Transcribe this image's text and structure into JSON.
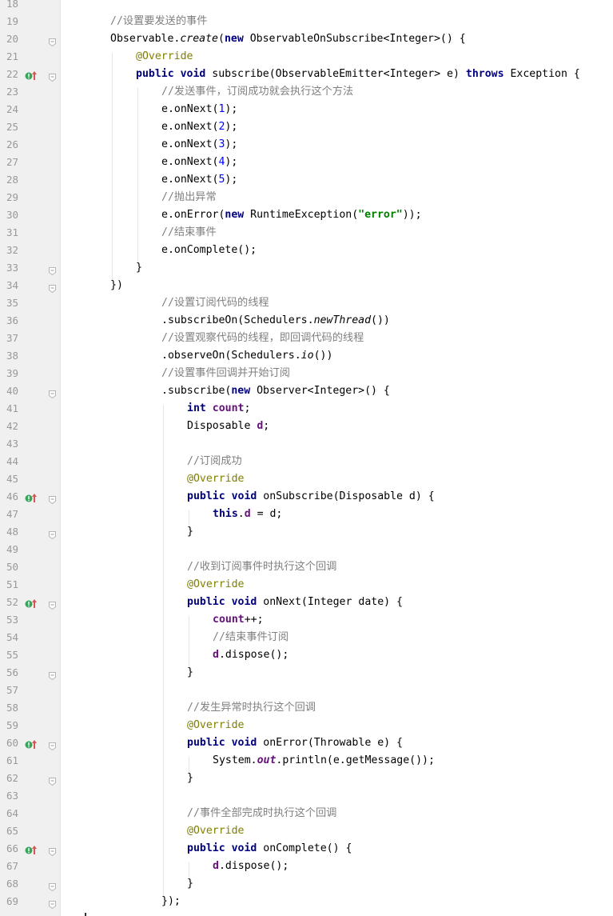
{
  "editor": {
    "lines": [
      {
        "n": "18",
        "indent": 0,
        "fold": false,
        "mark": false,
        "tokens": []
      },
      {
        "n": "19",
        "indent": 0,
        "fold": false,
        "mark": false,
        "tokens": [
          [
            "c",
            "//设置要发送的事件"
          ]
        ]
      },
      {
        "n": "20",
        "indent": 0,
        "fold": true,
        "mark": false,
        "tokens": [
          [
            "",
            "Observable."
          ],
          [
            "i",
            "create"
          ],
          [
            "",
            "("
          ],
          [
            "k",
            "new"
          ],
          [
            "",
            " ObservableOnSubscribe<Integer>() {"
          ]
        ]
      },
      {
        "n": "21",
        "indent": 1,
        "fold": false,
        "mark": false,
        "tokens": [
          [
            "a",
            "@Override"
          ]
        ]
      },
      {
        "n": "22",
        "indent": 1,
        "fold": true,
        "mark": true,
        "tokens": [
          [
            "k",
            "public void"
          ],
          [
            "",
            " subscribe(ObservableEmitter<Integer> e) "
          ],
          [
            "k",
            "throws"
          ],
          [
            "",
            " Exception {"
          ]
        ]
      },
      {
        "n": "23",
        "indent": 2,
        "fold": false,
        "mark": false,
        "tokens": [
          [
            "c",
            "//发送事件，订阅成功就会执行这个方法"
          ]
        ]
      },
      {
        "n": "24",
        "indent": 2,
        "fold": false,
        "mark": false,
        "tokens": [
          [
            "",
            "e.onNext("
          ],
          [
            "n",
            "1"
          ],
          [
            "",
            ");"
          ]
        ]
      },
      {
        "n": "25",
        "indent": 2,
        "fold": false,
        "mark": false,
        "tokens": [
          [
            "",
            "e.onNext("
          ],
          [
            "n",
            "2"
          ],
          [
            "",
            ");"
          ]
        ]
      },
      {
        "n": "26",
        "indent": 2,
        "fold": false,
        "mark": false,
        "tokens": [
          [
            "",
            "e.onNext("
          ],
          [
            "n",
            "3"
          ],
          [
            "",
            ");"
          ]
        ]
      },
      {
        "n": "27",
        "indent": 2,
        "fold": false,
        "mark": false,
        "tokens": [
          [
            "",
            "e.onNext("
          ],
          [
            "n",
            "4"
          ],
          [
            "",
            ");"
          ]
        ]
      },
      {
        "n": "28",
        "indent": 2,
        "fold": false,
        "mark": false,
        "tokens": [
          [
            "",
            "e.onNext("
          ],
          [
            "n",
            "5"
          ],
          [
            "",
            ");"
          ]
        ]
      },
      {
        "n": "29",
        "indent": 2,
        "fold": false,
        "mark": false,
        "tokens": [
          [
            "c",
            "//抛出异常"
          ]
        ]
      },
      {
        "n": "30",
        "indent": 2,
        "fold": false,
        "mark": false,
        "tokens": [
          [
            "",
            "e.onError("
          ],
          [
            "k",
            "new"
          ],
          [
            "",
            " RuntimeException("
          ],
          [
            "s",
            "\"error\""
          ],
          [
            "",
            "));"
          ]
        ]
      },
      {
        "n": "31",
        "indent": 2,
        "fold": false,
        "mark": false,
        "tokens": [
          [
            "c",
            "//结束事件"
          ]
        ]
      },
      {
        "n": "32",
        "indent": 2,
        "fold": false,
        "mark": false,
        "tokens": [
          [
            "",
            "e.onComplete();"
          ]
        ]
      },
      {
        "n": "33",
        "indent": 1,
        "fold": true,
        "mark": false,
        "tokens": [
          [
            "",
            "}"
          ]
        ]
      },
      {
        "n": "34",
        "indent": 0,
        "fold": true,
        "mark": false,
        "tokens": [
          [
            "",
            "})"
          ]
        ]
      },
      {
        "n": "35",
        "indent": 2,
        "fold": false,
        "mark": false,
        "tokens": [
          [
            "c",
            "//设置订阅代码的线程"
          ]
        ]
      },
      {
        "n": "36",
        "indent": 2,
        "fold": false,
        "mark": false,
        "tokens": [
          [
            "",
            ".subscribeOn(Schedulers."
          ],
          [
            "i",
            "newThread"
          ],
          [
            "",
            "())"
          ]
        ]
      },
      {
        "n": "37",
        "indent": 2,
        "fold": false,
        "mark": false,
        "tokens": [
          [
            "c",
            "//设置观察代码的线程，即回调代码的线程"
          ]
        ]
      },
      {
        "n": "38",
        "indent": 2,
        "fold": false,
        "mark": false,
        "tokens": [
          [
            "",
            ".observeOn(Schedulers."
          ],
          [
            "i",
            "io"
          ],
          [
            "",
            "())"
          ]
        ]
      },
      {
        "n": "39",
        "indent": 2,
        "fold": false,
        "mark": false,
        "tokens": [
          [
            "c",
            "//设置事件回调并开始订阅"
          ]
        ]
      },
      {
        "n": "40",
        "indent": 2,
        "fold": true,
        "mark": false,
        "tokens": [
          [
            "",
            ".subscribe("
          ],
          [
            "k",
            "new"
          ],
          [
            "",
            " Observer<Integer>() {"
          ]
        ]
      },
      {
        "n": "41",
        "indent": 3,
        "fold": false,
        "mark": false,
        "tokens": [
          [
            "k",
            "int"
          ],
          [
            "",
            " "
          ],
          [
            "f",
            "count"
          ],
          [
            "",
            ";"
          ]
        ]
      },
      {
        "n": "42",
        "indent": 3,
        "fold": false,
        "mark": false,
        "tokens": [
          [
            "",
            "Disposable "
          ],
          [
            "f",
            "d"
          ],
          [
            "",
            ";"
          ]
        ]
      },
      {
        "n": "43",
        "indent": 3,
        "fold": false,
        "mark": false,
        "tokens": []
      },
      {
        "n": "44",
        "indent": 3,
        "fold": false,
        "mark": false,
        "tokens": [
          [
            "c",
            "//订阅成功"
          ]
        ]
      },
      {
        "n": "45",
        "indent": 3,
        "fold": false,
        "mark": false,
        "tokens": [
          [
            "a",
            "@Override"
          ]
        ]
      },
      {
        "n": "46",
        "indent": 3,
        "fold": true,
        "mark": true,
        "tokens": [
          [
            "k",
            "public void"
          ],
          [
            "",
            " onSubscribe(Disposable d) {"
          ]
        ]
      },
      {
        "n": "47",
        "indent": 4,
        "fold": false,
        "mark": false,
        "tokens": [
          [
            "k",
            "this"
          ],
          [
            "",
            "."
          ],
          [
            "f",
            "d"
          ],
          [
            "",
            " = d;"
          ]
        ]
      },
      {
        "n": "48",
        "indent": 3,
        "fold": true,
        "mark": false,
        "tokens": [
          [
            "",
            "}"
          ]
        ]
      },
      {
        "n": "49",
        "indent": 3,
        "fold": false,
        "mark": false,
        "tokens": []
      },
      {
        "n": "50",
        "indent": 3,
        "fold": false,
        "mark": false,
        "tokens": [
          [
            "c",
            "//收到订阅事件时执行这个回调"
          ]
        ]
      },
      {
        "n": "51",
        "indent": 3,
        "fold": false,
        "mark": false,
        "tokens": [
          [
            "a",
            "@Override"
          ]
        ]
      },
      {
        "n": "52",
        "indent": 3,
        "fold": true,
        "mark": true,
        "tokens": [
          [
            "k",
            "public void"
          ],
          [
            "",
            " onNext(Integer date) {"
          ]
        ]
      },
      {
        "n": "53",
        "indent": 4,
        "fold": false,
        "mark": false,
        "tokens": [
          [
            "f",
            "count"
          ],
          [
            "",
            "++;"
          ]
        ]
      },
      {
        "n": "54",
        "indent": 4,
        "fold": false,
        "mark": false,
        "tokens": [
          [
            "c",
            "//结束事件订阅"
          ]
        ]
      },
      {
        "n": "55",
        "indent": 4,
        "fold": false,
        "mark": false,
        "tokens": [
          [
            "f",
            "d"
          ],
          [
            "",
            ".dispose();"
          ]
        ]
      },
      {
        "n": "56",
        "indent": 3,
        "fold": true,
        "mark": false,
        "tokens": [
          [
            "",
            "}"
          ]
        ]
      },
      {
        "n": "57",
        "indent": 3,
        "fold": false,
        "mark": false,
        "tokens": []
      },
      {
        "n": "58",
        "indent": 3,
        "fold": false,
        "mark": false,
        "tokens": [
          [
            "c",
            "//发生异常时执行这个回调"
          ]
        ]
      },
      {
        "n": "59",
        "indent": 3,
        "fold": false,
        "mark": false,
        "tokens": [
          [
            "a",
            "@Override"
          ]
        ]
      },
      {
        "n": "60",
        "indent": 3,
        "fold": true,
        "mark": true,
        "tokens": [
          [
            "k",
            "public void"
          ],
          [
            "",
            " onError(Throwable e) {"
          ]
        ]
      },
      {
        "n": "61",
        "indent": 4,
        "fold": false,
        "mark": false,
        "tokens": [
          [
            "",
            "System."
          ],
          [
            "fi",
            "out"
          ],
          [
            "",
            ".println(e.getMessage());"
          ]
        ]
      },
      {
        "n": "62",
        "indent": 3,
        "fold": true,
        "mark": false,
        "tokens": [
          [
            "",
            "}"
          ]
        ]
      },
      {
        "n": "63",
        "indent": 3,
        "fold": false,
        "mark": false,
        "tokens": []
      },
      {
        "n": "64",
        "indent": 3,
        "fold": false,
        "mark": false,
        "tokens": [
          [
            "c",
            "//事件全部完成时执行这个回调"
          ]
        ]
      },
      {
        "n": "65",
        "indent": 3,
        "fold": false,
        "mark": false,
        "tokens": [
          [
            "a",
            "@Override"
          ]
        ]
      },
      {
        "n": "66",
        "indent": 3,
        "fold": true,
        "mark": true,
        "tokens": [
          [
            "k",
            "public void"
          ],
          [
            "",
            " onComplete() {"
          ]
        ]
      },
      {
        "n": "67",
        "indent": 4,
        "fold": false,
        "mark": false,
        "tokens": [
          [
            "f",
            "d"
          ],
          [
            "",
            ".dispose();"
          ]
        ]
      },
      {
        "n": "68",
        "indent": 3,
        "fold": true,
        "mark": false,
        "tokens": [
          [
            "",
            "}"
          ]
        ]
      },
      {
        "n": "69",
        "indent": 2,
        "fold": true,
        "mark": false,
        "tokens": [
          [
            "",
            "});"
          ]
        ]
      }
    ]
  },
  "icons": {
    "override_marker": "override-method-icon",
    "fold": "fold-toggle-icon"
  },
  "colors": {
    "keyword": "#000080",
    "comment": "#808080",
    "annotation": "#808000",
    "number": "#0000ff",
    "string": "#008000",
    "field": "#660e7a",
    "gutter_bg": "#f0f0f0",
    "line_number": "#999999"
  }
}
